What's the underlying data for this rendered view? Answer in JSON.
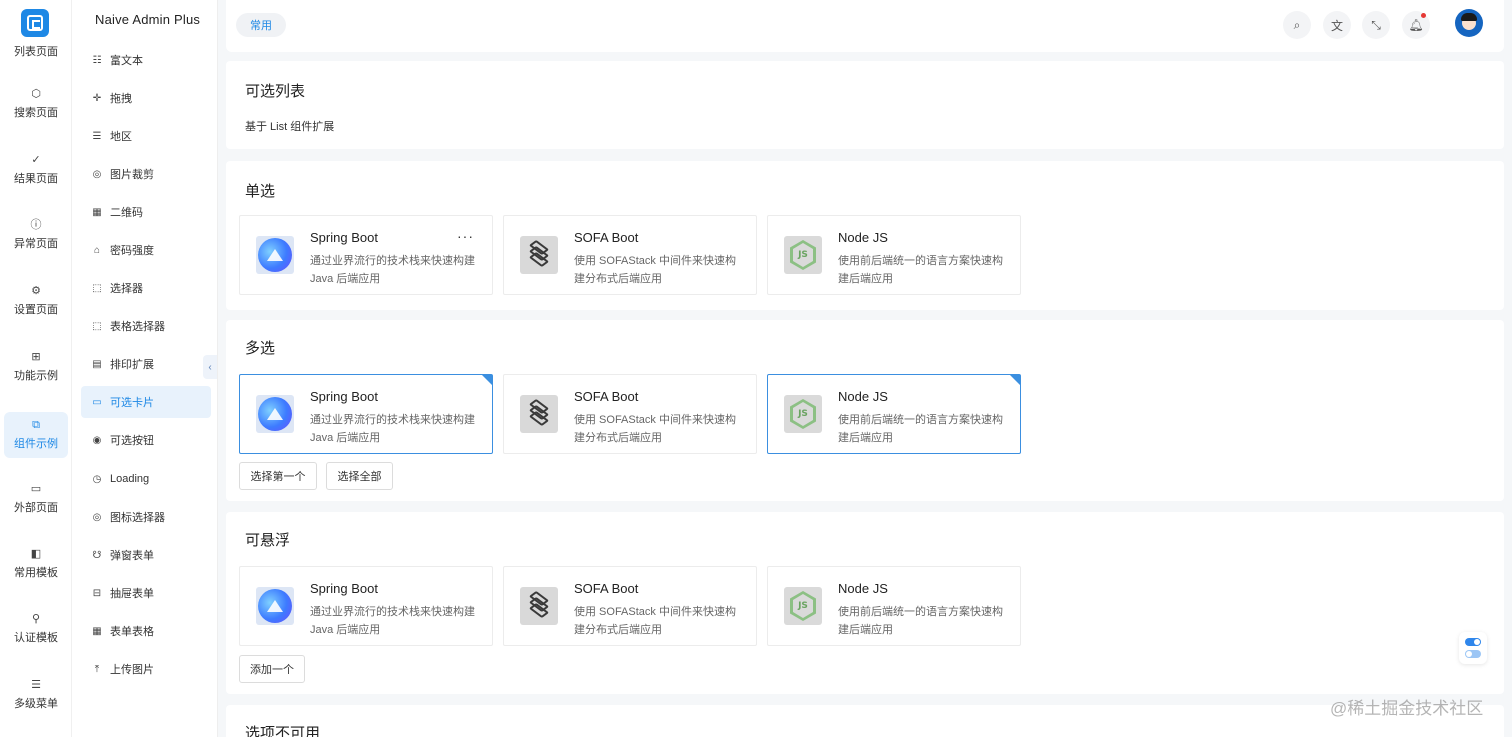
{
  "app": {
    "title": "Naive Admin Plus"
  },
  "rail": {
    "top_partial_label": "列表页面",
    "items": [
      {
        "label": "搜索页面",
        "icon": "cube-icon"
      },
      {
        "label": "结果页面",
        "icon": "check-circle-icon"
      },
      {
        "label": "异常页面",
        "icon": "alert-circle-icon"
      },
      {
        "label": "设置页面",
        "icon": "settings-icon"
      },
      {
        "label": "功能示例",
        "icon": "grid-icon"
      },
      {
        "label": "组件示例",
        "icon": "component-icon",
        "active": true
      },
      {
        "label": "外部页面",
        "icon": "monitor-icon"
      },
      {
        "label": "常用模板",
        "icon": "template-icon"
      },
      {
        "label": "认证模板",
        "icon": "key-icon"
      },
      {
        "label": "多级菜单",
        "icon": "menu-icon"
      }
    ]
  },
  "sidebar": {
    "items": [
      {
        "label": "富文本",
        "icon": "richtext-icon"
      },
      {
        "label": "拖拽",
        "icon": "drag-icon"
      },
      {
        "label": "地区",
        "icon": "region-icon"
      },
      {
        "label": "图片裁剪",
        "icon": "crop-icon"
      },
      {
        "label": "二维码",
        "icon": "qrcode-icon"
      },
      {
        "label": "密码强度",
        "icon": "lock-icon"
      },
      {
        "label": "选择器",
        "icon": "selector-icon"
      },
      {
        "label": "表格选择器",
        "icon": "table-selector-icon"
      },
      {
        "label": "排印扩展",
        "icon": "print-icon"
      },
      {
        "label": "可选卡片",
        "icon": "card-icon",
        "active": true
      },
      {
        "label": "可选按钮",
        "icon": "radio-icon"
      },
      {
        "label": "Loading",
        "icon": "clock-icon"
      },
      {
        "label": "图标选择器",
        "icon": "icon-picker-icon"
      },
      {
        "label": "弹窗表单",
        "icon": "popup-icon"
      },
      {
        "label": "抽屉表单",
        "icon": "drawer-icon"
      },
      {
        "label": "表单表格",
        "icon": "form-table-icon"
      },
      {
        "label": "上传图片",
        "icon": "upload-icon"
      }
    ]
  },
  "header": {
    "tab": "常用"
  },
  "intro": {
    "title": "可选列表",
    "subtitle": "基于 List 组件扩展"
  },
  "cards": {
    "spring": {
      "name": "Spring Boot",
      "desc": "通过业界流行的技术栈来快速构建 Java 后端应用"
    },
    "sofa": {
      "name": "SOFA Boot",
      "desc": "使用 SOFAStack 中间件来快速构建分布式后端应用"
    },
    "node": {
      "name": "Node JS",
      "desc": "使用前后端统一的语言方案快速构建后端应用"
    },
    "node_logo_text": "JS",
    "more": "···"
  },
  "sections": {
    "single": {
      "title": "单选"
    },
    "multi": {
      "title": "多选",
      "btn_first": "选择第一个",
      "btn_all": "选择全部"
    },
    "hover": {
      "title": "可悬浮",
      "btn_add": "添加一个"
    },
    "disabled": {
      "title": "选项不可用"
    }
  },
  "watermark": "@稀土掘金技术社区",
  "colors": {
    "primary": "#1e88e5",
    "selected_border": "#3b8fe0"
  }
}
